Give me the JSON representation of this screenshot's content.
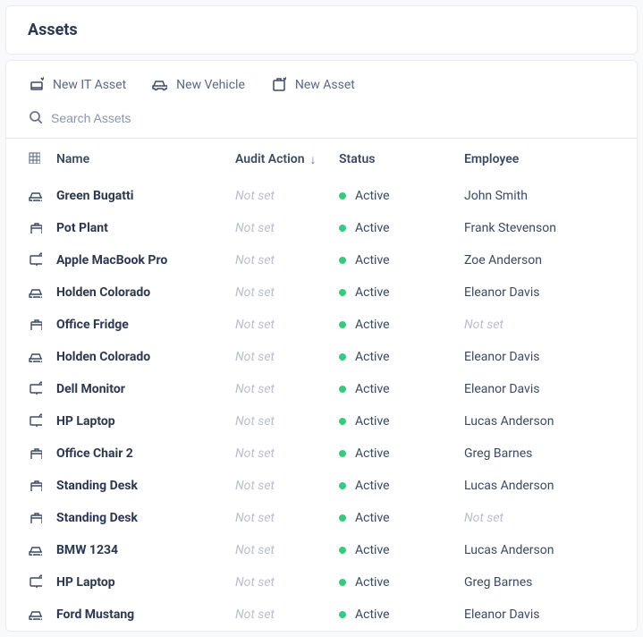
{
  "header": {
    "title": "Assets"
  },
  "toolbar": {
    "new_it_asset": "New IT Asset",
    "new_vehicle": "New Vehicle",
    "new_asset": "New Asset"
  },
  "search": {
    "placeholder": "Search Assets"
  },
  "columns": {
    "name": "Name",
    "audit_action": "Audit Action",
    "status": "Status",
    "employee": "Employee"
  },
  "not_set_label": "Not set",
  "status_active": "Active",
  "rows": [
    {
      "icon": "vehicle",
      "name": "Green Bugatti",
      "audit": null,
      "status": "Active",
      "employee": "John Smith"
    },
    {
      "icon": "box",
      "name": "Pot Plant",
      "audit": null,
      "status": "Active",
      "employee": "Frank Stevenson"
    },
    {
      "icon": "it",
      "name": "Apple MacBook Pro",
      "audit": null,
      "status": "Active",
      "employee": "Zoe Anderson"
    },
    {
      "icon": "vehicle",
      "name": "Holden Colorado",
      "audit": null,
      "status": "Active",
      "employee": "Eleanor Davis"
    },
    {
      "icon": "box",
      "name": "Office Fridge",
      "audit": null,
      "status": "Active",
      "employee": null
    },
    {
      "icon": "vehicle",
      "name": "Holden Colorado",
      "audit": null,
      "status": "Active",
      "employee": "Eleanor Davis"
    },
    {
      "icon": "it",
      "name": "Dell Monitor",
      "audit": null,
      "status": "Active",
      "employee": "Eleanor Davis"
    },
    {
      "icon": "it",
      "name": "HP Laptop",
      "audit": null,
      "status": "Active",
      "employee": "Lucas Anderson"
    },
    {
      "icon": "box",
      "name": "Office Chair 2",
      "audit": null,
      "status": "Active",
      "employee": "Greg Barnes"
    },
    {
      "icon": "box",
      "name": "Standing Desk",
      "audit": null,
      "status": "Active",
      "employee": "Lucas Anderson"
    },
    {
      "icon": "box",
      "name": "Standing Desk",
      "audit": null,
      "status": "Active",
      "employee": null
    },
    {
      "icon": "vehicle",
      "name": "BMW 1234",
      "audit": null,
      "status": "Active",
      "employee": "Lucas Anderson"
    },
    {
      "icon": "it",
      "name": "HP Laptop",
      "audit": null,
      "status": "Active",
      "employee": "Greg Barnes"
    },
    {
      "icon": "vehicle",
      "name": "Ford Mustang",
      "audit": null,
      "status": "Active",
      "employee": "Eleanor Davis"
    }
  ]
}
